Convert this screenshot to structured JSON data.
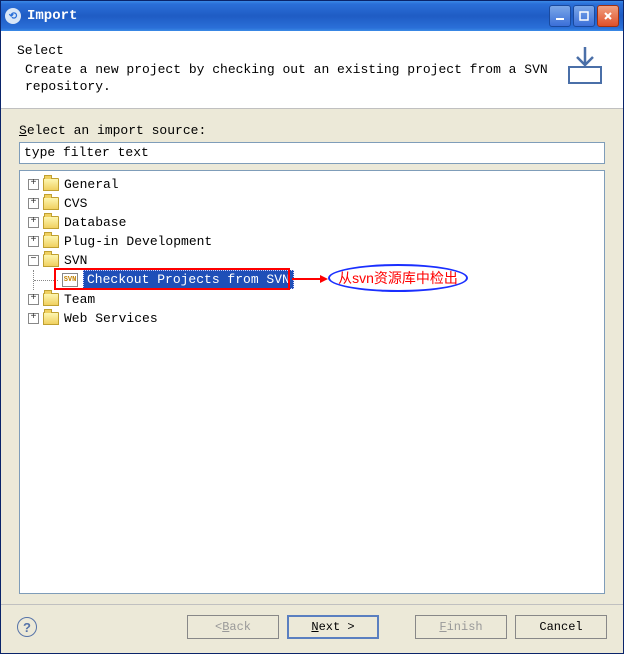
{
  "titlebar": {
    "title": "Import"
  },
  "header": {
    "select_label": "Select",
    "description": "Create a new project by checking out an existing project from a SVN repository."
  },
  "source": {
    "label_prefix": "Select an import source:",
    "filter_placeholder": "type filter text"
  },
  "tree": {
    "items": [
      {
        "label": "General",
        "expanded": false
      },
      {
        "label": "CVS",
        "expanded": false
      },
      {
        "label": "Database",
        "expanded": false
      },
      {
        "label": "Plug-in Development",
        "expanded": false
      },
      {
        "label": "SVN",
        "expanded": true,
        "children": [
          {
            "label": "Checkout Projects from SVN",
            "selected": true
          }
        ]
      },
      {
        "label": "Team",
        "expanded": false
      },
      {
        "label": "Web Services",
        "expanded": false
      }
    ]
  },
  "annotation": {
    "text": "从svn资源库中检出"
  },
  "buttons": {
    "back": "< Back",
    "next": "Next >",
    "finish": "Finish",
    "cancel": "Cancel"
  }
}
